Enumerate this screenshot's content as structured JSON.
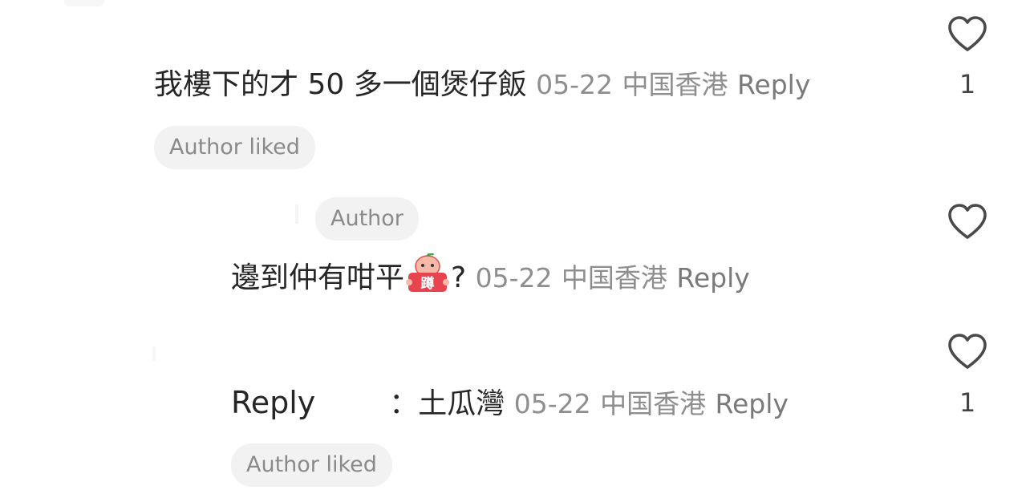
{
  "comment1": {
    "text": "我樓下的才 50 多一個煲仔飯",
    "date": "05-22",
    "location": "中国香港",
    "reply_label": "Reply",
    "badge": "Author liked",
    "like_count": "1"
  },
  "comment2": {
    "author_badge": "Author",
    "text": "邊到仲有咁平",
    "sticker_label": "蹲",
    "suffix": "?",
    "date": "05-22",
    "location": "中国香港",
    "reply_label": "Reply"
  },
  "comment3": {
    "name_text": "Reply",
    "text": "：土瓜灣",
    "date": "05-22",
    "location": "中国香港",
    "reply_label": "Reply",
    "badge": "Author liked",
    "like_count": "1"
  },
  "icons": {
    "heart": "heart-outline-icon"
  },
  "colors": {
    "text": "#262626",
    "meta": "#8e8e8e",
    "pill_bg": "#f2f2f2",
    "sticker_red": "#e8434f"
  }
}
